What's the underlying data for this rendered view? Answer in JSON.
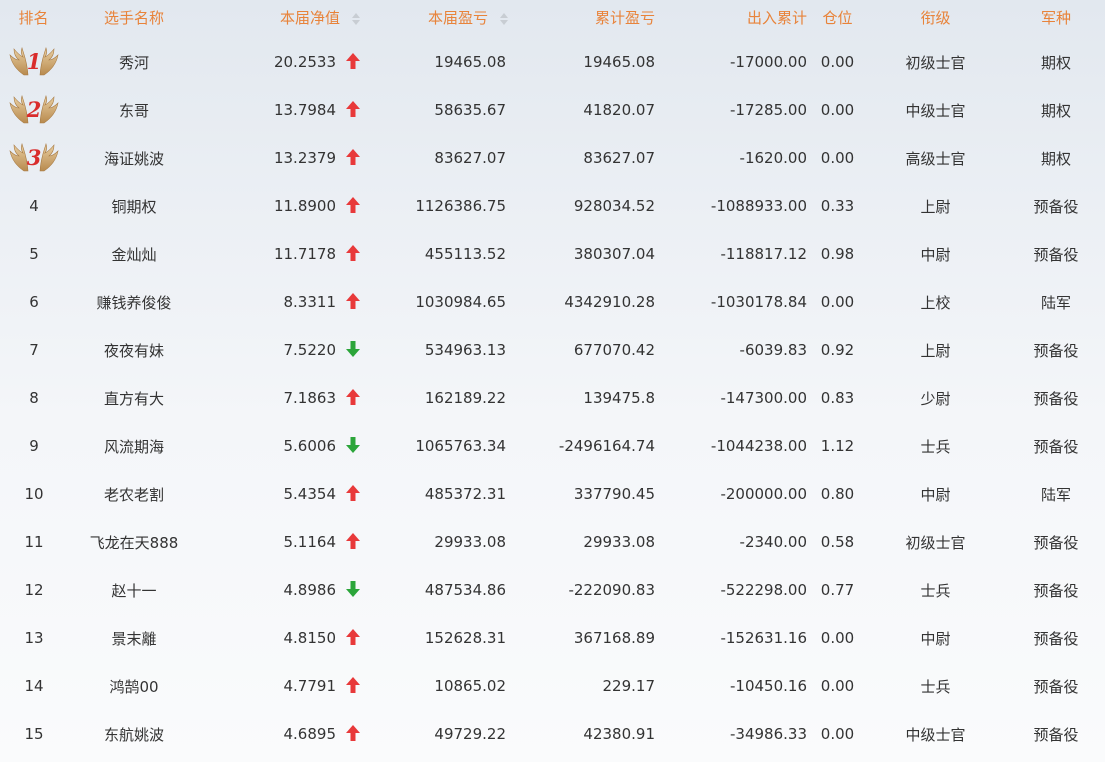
{
  "headers": {
    "rank": "排名",
    "name": "选手名称",
    "nav": "本届净值",
    "pnl": "本届盈亏",
    "cum_pnl": "累计盈亏",
    "flow": "出入累计",
    "position": "仓位",
    "title": "衔级",
    "branch": "军种"
  },
  "colors": {
    "header_text": "#e8833a",
    "up_arrow": "#e8393a",
    "down_arrow": "#2ba53a",
    "medal_number": "#d92c2c",
    "medal_wing": "#c9a06a"
  },
  "icons": {
    "medal": "gold-wings-medal-icon",
    "up": "red-up-arrow-icon",
    "down": "green-down-arrow-icon",
    "sort": "sort-caret-icon"
  },
  "rows": [
    {
      "rank": "1",
      "name": "秀河",
      "nav": "20.2533",
      "trend": "up",
      "pnl": "19465.08",
      "cum_pnl": "19465.08",
      "flow": "-17000.00",
      "position": "0.00",
      "title": "初级士官",
      "branch": "期权"
    },
    {
      "rank": "2",
      "name": "东哥",
      "nav": "13.7984",
      "trend": "up",
      "pnl": "58635.67",
      "cum_pnl": "41820.07",
      "flow": "-17285.00",
      "position": "0.00",
      "title": "中级士官",
      "branch": "期权"
    },
    {
      "rank": "3",
      "name": "海证姚波",
      "nav": "13.2379",
      "trend": "up",
      "pnl": "83627.07",
      "cum_pnl": "83627.07",
      "flow": "-1620.00",
      "position": "0.00",
      "title": "高级士官",
      "branch": "期权"
    },
    {
      "rank": "4",
      "name": "铜期权",
      "nav": "11.8900",
      "trend": "up",
      "pnl": "1126386.75",
      "cum_pnl": "928034.52",
      "flow": "-1088933.00",
      "position": "0.33",
      "title": "上尉",
      "branch": "预备役"
    },
    {
      "rank": "5",
      "name": "金灿灿",
      "nav": "11.7178",
      "trend": "up",
      "pnl": "455113.52",
      "cum_pnl": "380307.04",
      "flow": "-118817.12",
      "position": "0.98",
      "title": "中尉",
      "branch": "预备役"
    },
    {
      "rank": "6",
      "name": "赚钱养俊俊",
      "nav": "8.3311",
      "trend": "up",
      "pnl": "1030984.65",
      "cum_pnl": "4342910.28",
      "flow": "-1030178.84",
      "position": "0.00",
      "title": "上校",
      "branch": "陆军"
    },
    {
      "rank": "7",
      "name": "夜夜有妹",
      "nav": "7.5220",
      "trend": "down",
      "pnl": "534963.13",
      "cum_pnl": "677070.42",
      "flow": "-6039.83",
      "position": "0.92",
      "title": "上尉",
      "branch": "预备役"
    },
    {
      "rank": "8",
      "name": "直方有大",
      "nav": "7.1863",
      "trend": "up",
      "pnl": "162189.22",
      "cum_pnl": "139475.8",
      "flow": "-147300.00",
      "position": "0.83",
      "title": "少尉",
      "branch": "预备役"
    },
    {
      "rank": "9",
      "name": "风流期海",
      "nav": "5.6006",
      "trend": "down",
      "pnl": "1065763.34",
      "cum_pnl": "-2496164.74",
      "flow": "-1044238.00",
      "position": "1.12",
      "title": "士兵",
      "branch": "预备役"
    },
    {
      "rank": "10",
      "name": "老农老割",
      "nav": "5.4354",
      "trend": "up",
      "pnl": "485372.31",
      "cum_pnl": "337790.45",
      "flow": "-200000.00",
      "position": "0.80",
      "title": "中尉",
      "branch": "陆军"
    },
    {
      "rank": "11",
      "name": "飞龙在天888",
      "nav": "5.1164",
      "trend": "up",
      "pnl": "29933.08",
      "cum_pnl": "29933.08",
      "flow": "-2340.00",
      "position": "0.58",
      "title": "初级士官",
      "branch": "预备役"
    },
    {
      "rank": "12",
      "name": "赵十一",
      "nav": "4.8986",
      "trend": "down",
      "pnl": "487534.86",
      "cum_pnl": "-222090.83",
      "flow": "-522298.00",
      "position": "0.77",
      "title": "士兵",
      "branch": "预备役"
    },
    {
      "rank": "13",
      "name": "景末離",
      "nav": "4.8150",
      "trend": "up",
      "pnl": "152628.31",
      "cum_pnl": "367168.89",
      "flow": "-152631.16",
      "position": "0.00",
      "title": "中尉",
      "branch": "预备役"
    },
    {
      "rank": "14",
      "name": "鸿鹄00",
      "nav": "4.7791",
      "trend": "up",
      "pnl": "10865.02",
      "cum_pnl": "229.17",
      "flow": "-10450.16",
      "position": "0.00",
      "title": "士兵",
      "branch": "预备役"
    },
    {
      "rank": "15",
      "name": "东航姚波",
      "nav": "4.6895",
      "trend": "up",
      "pnl": "49729.22",
      "cum_pnl": "42380.91",
      "flow": "-34986.33",
      "position": "0.00",
      "title": "中级士官",
      "branch": "预备役"
    }
  ]
}
